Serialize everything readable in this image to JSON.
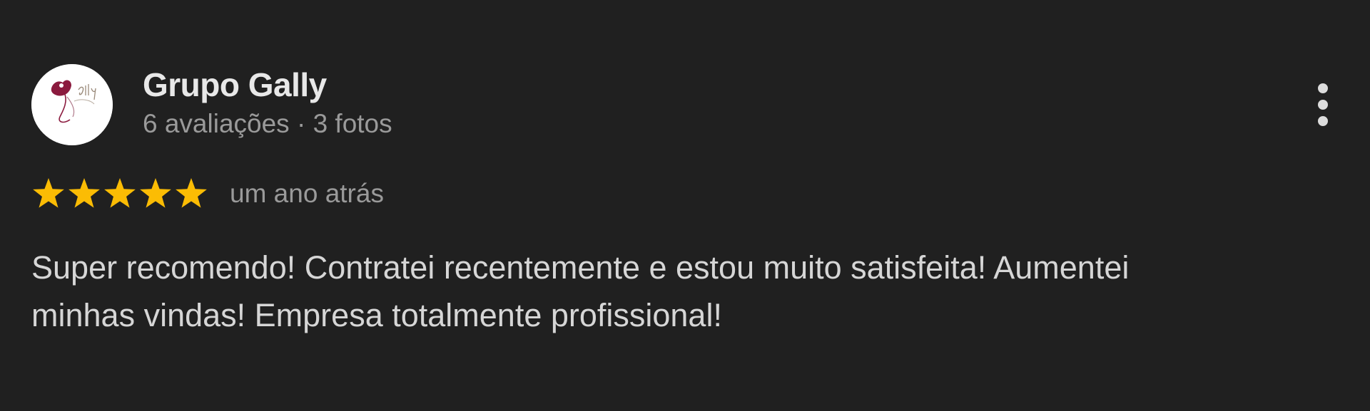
{
  "review": {
    "author_name": "Grupo Gally",
    "author_meta": "6 avaliações · 3 fotos",
    "avatar_icon": "gally-logo-icon",
    "rating": 5,
    "rating_max": 5,
    "date": "um ano atrás",
    "text_line1": "Super recomendo! Contratei recentemente e estou muito satisfeita! Aumentei",
    "text_line2": "minhas vindas! Empresa totalmente profissional!"
  },
  "actions": {
    "more_icon": "more-vertical-icon"
  },
  "colors": {
    "background": "#202020",
    "star": "#fbbc04",
    "name": "#e8e8e8",
    "meta": "#9a9a9a",
    "text": "#d6d6d6",
    "logo_accent": "#8b1a3e"
  }
}
